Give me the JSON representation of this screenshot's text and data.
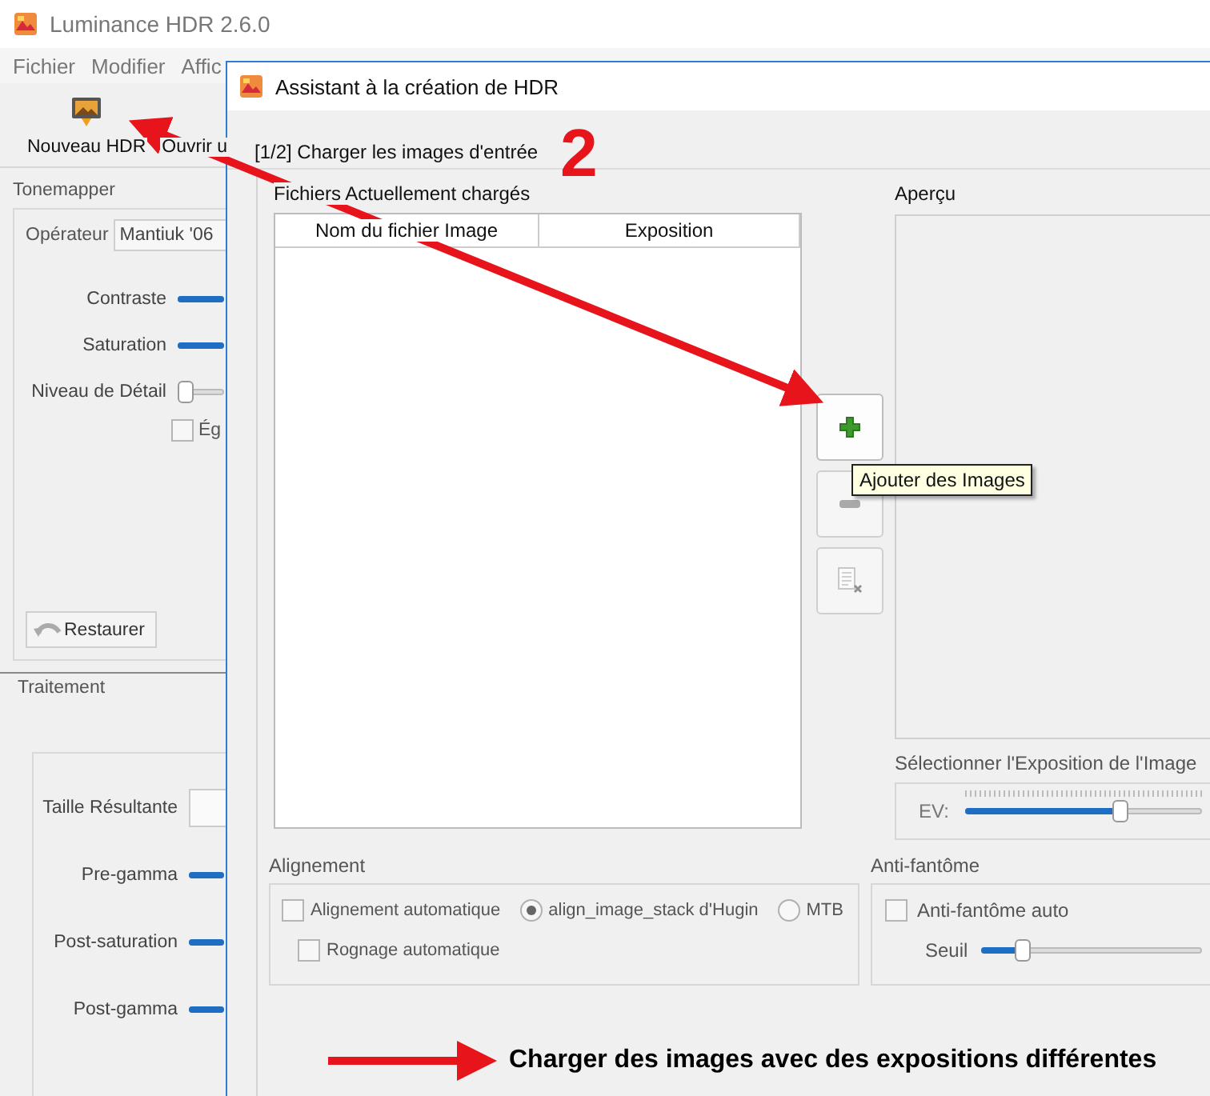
{
  "main_window": {
    "title": "Luminance HDR 2.6.0",
    "menu": [
      "Fichier",
      "Modifier",
      "Affic"
    ],
    "toolbar": [
      "Nouveau HDR",
      "Ouvrir u"
    ],
    "tonemapper": {
      "title": "Tonemapper",
      "operator_label": "Opérateur",
      "operator": "Mantiuk '06",
      "sliders": [
        {
          "label": "Contraste",
          "level": 1
        },
        {
          "label": "Saturation",
          "level": 1
        },
        {
          "label": "Niveau de Détail",
          "level": 0
        }
      ],
      "checkbox": {
        "label": "Ég",
        "checked": false
      },
      "reset_button": "Restaurer"
    },
    "processing": {
      "title": "Traitement",
      "size_label": "Taille Résultante",
      "sliders": [
        {
          "label": "Pre-gamma",
          "level": 1
        },
        {
          "label": "Post-saturation",
          "level": 1
        },
        {
          "label": "Post-gamma",
          "level": 1
        }
      ]
    }
  },
  "dialog": {
    "title": "Assistant à la création de HDR",
    "step": "[1/2] Charger les images d'entrée",
    "files_label": "Fichiers Actuellement chargés",
    "columns": [
      "Nom du fichier Image",
      "Exposition"
    ],
    "tool_buttons": [
      {
        "kind": "add",
        "disabled": false
      },
      {
        "kind": "remove",
        "disabled": true
      },
      {
        "kind": "clear",
        "disabled": true
      }
    ],
    "tooltip": "Ajouter des Images",
    "preview_label": "Aperçu",
    "exposure_label": "Sélectionner l'Exposition de l'Image",
    "ev": {
      "label": "EV:",
      "level": 0.67
    },
    "alignment": {
      "title": "Alignement",
      "auto": {
        "label": "Alignement automatique",
        "checked": false
      },
      "methods": [
        {
          "label": "align_image_stack d'Hugin",
          "selected": true
        },
        {
          "label": "MTB",
          "selected": false
        }
      ],
      "crop": {
        "label": "Rognage automatique",
        "checked": false
      }
    },
    "antighost": {
      "title": "Anti-fantôme",
      "auto": {
        "label": "Anti-fantôme auto",
        "checked": false
      },
      "threshold": {
        "label": "Seuil",
        "level": 0.17
      }
    }
  },
  "annotations": {
    "step_number": "2",
    "caption": "Charger des images avec des expositions différentes"
  }
}
